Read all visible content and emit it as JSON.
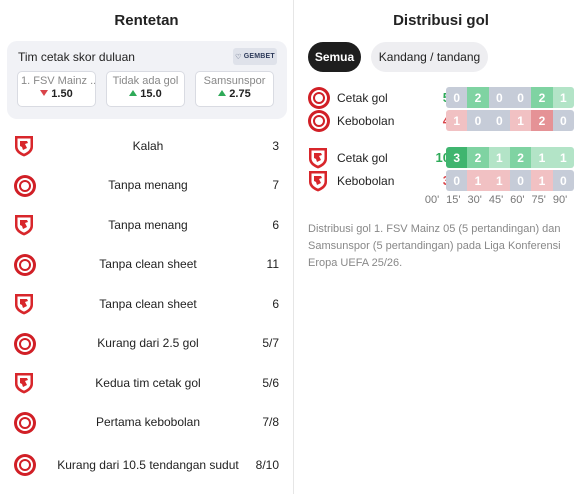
{
  "left": {
    "title": "Rentetan",
    "odds": {
      "title": "Tim cetak skor duluan",
      "brand": "GEMBET",
      "options": [
        {
          "label": "1. FSV Mainz ...",
          "value": "1.50",
          "trend": "down"
        },
        {
          "label": "Tidak ada gol",
          "value": "15.0",
          "trend": "up"
        },
        {
          "label": "Samsunspor",
          "value": "2.75",
          "trend": "up"
        }
      ]
    },
    "streaks": [
      {
        "team": "samsunspor",
        "label": "Kalah",
        "value": "3"
      },
      {
        "team": "mainz",
        "label": "Tanpa menang",
        "value": "7"
      },
      {
        "team": "samsunspor",
        "label": "Tanpa menang",
        "value": "6"
      },
      {
        "team": "mainz",
        "label": "Tanpa clean sheet",
        "value": "11"
      },
      {
        "team": "samsunspor",
        "label": "Tanpa clean sheet",
        "value": "6"
      },
      {
        "team": "mainz",
        "label": "Kurang dari 2.5 gol",
        "value": "5/7"
      },
      {
        "team": "samsunspor",
        "label": "Kedua tim cetak gol",
        "value": "5/6"
      },
      {
        "team": "mainz",
        "label": "Pertama kebobolan",
        "value": "7/8"
      },
      {
        "team": "mainz",
        "label": "Kurang dari 10.5 tendangan sudut",
        "value": "8/10"
      }
    ]
  },
  "right": {
    "title": "Distribusi gol",
    "tabs": [
      "Semua",
      "Kandang / tandang"
    ],
    "active_tab": "Semua",
    "teams": [
      {
        "team": "mainz",
        "rows": [
          {
            "label": "Cetak gol",
            "total": "5",
            "type": "scored",
            "values": [
              0,
              2,
              0,
              0,
              2,
              1
            ]
          },
          {
            "label": "Kebobolan",
            "total": "4",
            "type": "conceded",
            "values": [
              1,
              0,
              0,
              1,
              2,
              0
            ]
          }
        ]
      },
      {
        "team": "samsunspor",
        "rows": [
          {
            "label": "Cetak gol",
            "total": "10",
            "type": "scored",
            "values": [
              3,
              2,
              1,
              2,
              1,
              1
            ]
          },
          {
            "label": "Kebobolan",
            "total": "3",
            "type": "conceded",
            "values": [
              0,
              1,
              1,
              0,
              1,
              0
            ]
          }
        ]
      }
    ],
    "ticks": [
      "00'",
      "15'",
      "30'",
      "45'",
      "60'",
      "75'",
      "90'"
    ],
    "description": "Distribusi gol 1. FSV Mainz 05 (5 pertandingan) dan Samsunspor (5 pertandingan) pada Liga Konferensi Eropa UEFA 25/26."
  },
  "colors": {
    "scored_scale": [
      "#c6ccd8",
      "#b3e4c7",
      "#7fd3a2",
      "#3fb56f"
    ],
    "conceded_scale": [
      "#c6ccd8",
      "#f1c1c3",
      "#e59296",
      "#d9444a"
    ],
    "mainz_red": "#d11f26",
    "samsunspor_red": "#d8262b",
    "up": "#2eaa58",
    "down": "#d9444a"
  }
}
